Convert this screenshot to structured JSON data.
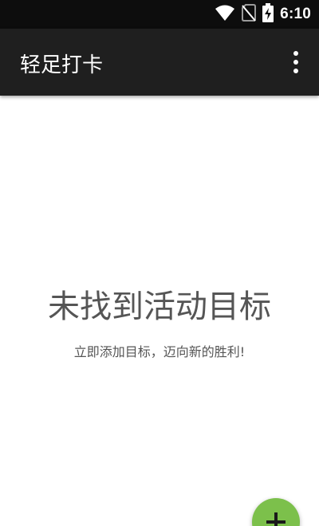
{
  "status_bar": {
    "time": "6:10",
    "icons": [
      "wifi-icon",
      "no-sim-icon",
      "battery-charging-icon"
    ]
  },
  "app_bar": {
    "title": "轻足打卡",
    "menu_icon": "more-vert-icon"
  },
  "empty_state": {
    "title": "未找到活动目标",
    "subtitle": "立即添加目标，迈向新的胜利!"
  },
  "fab": {
    "icon": "plus-icon",
    "color": "#7cc04b"
  },
  "colors": {
    "status_bar": "#0d0d0d",
    "app_bar": "#1f1f1f",
    "background": "#ffffff",
    "text_muted": "#555555",
    "accent": "#7cc04b"
  }
}
